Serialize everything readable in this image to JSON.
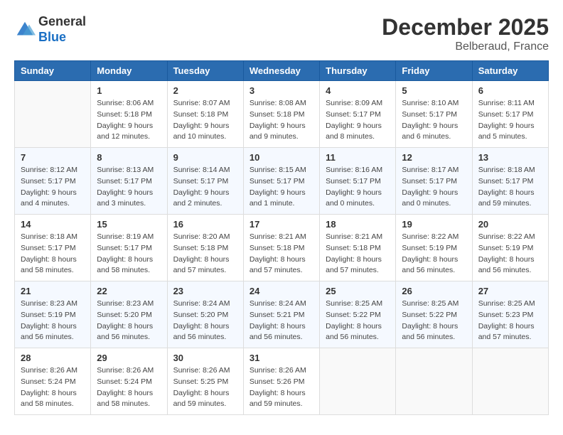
{
  "header": {
    "logo_general": "General",
    "logo_blue": "Blue",
    "month_year": "December 2025",
    "location": "Belberaud, France"
  },
  "days_of_week": [
    "Sunday",
    "Monday",
    "Tuesday",
    "Wednesday",
    "Thursday",
    "Friday",
    "Saturday"
  ],
  "weeks": [
    [
      {
        "date": "",
        "sunrise": "",
        "sunset": "",
        "daylight": ""
      },
      {
        "date": "1",
        "sunrise": "Sunrise: 8:06 AM",
        "sunset": "Sunset: 5:18 PM",
        "daylight": "Daylight: 9 hours and 12 minutes."
      },
      {
        "date": "2",
        "sunrise": "Sunrise: 8:07 AM",
        "sunset": "Sunset: 5:18 PM",
        "daylight": "Daylight: 9 hours and 10 minutes."
      },
      {
        "date": "3",
        "sunrise": "Sunrise: 8:08 AM",
        "sunset": "Sunset: 5:18 PM",
        "daylight": "Daylight: 9 hours and 9 minutes."
      },
      {
        "date": "4",
        "sunrise": "Sunrise: 8:09 AM",
        "sunset": "Sunset: 5:17 PM",
        "daylight": "Daylight: 9 hours and 8 minutes."
      },
      {
        "date": "5",
        "sunrise": "Sunrise: 8:10 AM",
        "sunset": "Sunset: 5:17 PM",
        "daylight": "Daylight: 9 hours and 6 minutes."
      },
      {
        "date": "6",
        "sunrise": "Sunrise: 8:11 AM",
        "sunset": "Sunset: 5:17 PM",
        "daylight": "Daylight: 9 hours and 5 minutes."
      }
    ],
    [
      {
        "date": "7",
        "sunrise": "Sunrise: 8:12 AM",
        "sunset": "Sunset: 5:17 PM",
        "daylight": "Daylight: 9 hours and 4 minutes."
      },
      {
        "date": "8",
        "sunrise": "Sunrise: 8:13 AM",
        "sunset": "Sunset: 5:17 PM",
        "daylight": "Daylight: 9 hours and 3 minutes."
      },
      {
        "date": "9",
        "sunrise": "Sunrise: 8:14 AM",
        "sunset": "Sunset: 5:17 PM",
        "daylight": "Daylight: 9 hours and 2 minutes."
      },
      {
        "date": "10",
        "sunrise": "Sunrise: 8:15 AM",
        "sunset": "Sunset: 5:17 PM",
        "daylight": "Daylight: 9 hours and 1 minute."
      },
      {
        "date": "11",
        "sunrise": "Sunrise: 8:16 AM",
        "sunset": "Sunset: 5:17 PM",
        "daylight": "Daylight: 9 hours and 0 minutes."
      },
      {
        "date": "12",
        "sunrise": "Sunrise: 8:17 AM",
        "sunset": "Sunset: 5:17 PM",
        "daylight": "Daylight: 9 hours and 0 minutes."
      },
      {
        "date": "13",
        "sunrise": "Sunrise: 8:18 AM",
        "sunset": "Sunset: 5:17 PM",
        "daylight": "Daylight: 8 hours and 59 minutes."
      }
    ],
    [
      {
        "date": "14",
        "sunrise": "Sunrise: 8:18 AM",
        "sunset": "Sunset: 5:17 PM",
        "daylight": "Daylight: 8 hours and 58 minutes."
      },
      {
        "date": "15",
        "sunrise": "Sunrise: 8:19 AM",
        "sunset": "Sunset: 5:17 PM",
        "daylight": "Daylight: 8 hours and 58 minutes."
      },
      {
        "date": "16",
        "sunrise": "Sunrise: 8:20 AM",
        "sunset": "Sunset: 5:18 PM",
        "daylight": "Daylight: 8 hours and 57 minutes."
      },
      {
        "date": "17",
        "sunrise": "Sunrise: 8:21 AM",
        "sunset": "Sunset: 5:18 PM",
        "daylight": "Daylight: 8 hours and 57 minutes."
      },
      {
        "date": "18",
        "sunrise": "Sunrise: 8:21 AM",
        "sunset": "Sunset: 5:18 PM",
        "daylight": "Daylight: 8 hours and 57 minutes."
      },
      {
        "date": "19",
        "sunrise": "Sunrise: 8:22 AM",
        "sunset": "Sunset: 5:19 PM",
        "daylight": "Daylight: 8 hours and 56 minutes."
      },
      {
        "date": "20",
        "sunrise": "Sunrise: 8:22 AM",
        "sunset": "Sunset: 5:19 PM",
        "daylight": "Daylight: 8 hours and 56 minutes."
      }
    ],
    [
      {
        "date": "21",
        "sunrise": "Sunrise: 8:23 AM",
        "sunset": "Sunset: 5:19 PM",
        "daylight": "Daylight: 8 hours and 56 minutes."
      },
      {
        "date": "22",
        "sunrise": "Sunrise: 8:23 AM",
        "sunset": "Sunset: 5:20 PM",
        "daylight": "Daylight: 8 hours and 56 minutes."
      },
      {
        "date": "23",
        "sunrise": "Sunrise: 8:24 AM",
        "sunset": "Sunset: 5:20 PM",
        "daylight": "Daylight: 8 hours and 56 minutes."
      },
      {
        "date": "24",
        "sunrise": "Sunrise: 8:24 AM",
        "sunset": "Sunset: 5:21 PM",
        "daylight": "Daylight: 8 hours and 56 minutes."
      },
      {
        "date": "25",
        "sunrise": "Sunrise: 8:25 AM",
        "sunset": "Sunset: 5:22 PM",
        "daylight": "Daylight: 8 hours and 56 minutes."
      },
      {
        "date": "26",
        "sunrise": "Sunrise: 8:25 AM",
        "sunset": "Sunset: 5:22 PM",
        "daylight": "Daylight: 8 hours and 56 minutes."
      },
      {
        "date": "27",
        "sunrise": "Sunrise: 8:25 AM",
        "sunset": "Sunset: 5:23 PM",
        "daylight": "Daylight: 8 hours and 57 minutes."
      }
    ],
    [
      {
        "date": "28",
        "sunrise": "Sunrise: 8:26 AM",
        "sunset": "Sunset: 5:24 PM",
        "daylight": "Daylight: 8 hours and 58 minutes."
      },
      {
        "date": "29",
        "sunrise": "Sunrise: 8:26 AM",
        "sunset": "Sunset: 5:24 PM",
        "daylight": "Daylight: 8 hours and 58 minutes."
      },
      {
        "date": "30",
        "sunrise": "Sunrise: 8:26 AM",
        "sunset": "Sunset: 5:25 PM",
        "daylight": "Daylight: 8 hours and 59 minutes."
      },
      {
        "date": "31",
        "sunrise": "Sunrise: 8:26 AM",
        "sunset": "Sunset: 5:26 PM",
        "daylight": "Daylight: 8 hours and 59 minutes."
      },
      {
        "date": "",
        "sunrise": "",
        "sunset": "",
        "daylight": ""
      },
      {
        "date": "",
        "sunrise": "",
        "sunset": "",
        "daylight": ""
      },
      {
        "date": "",
        "sunrise": "",
        "sunset": "",
        "daylight": ""
      }
    ]
  ]
}
